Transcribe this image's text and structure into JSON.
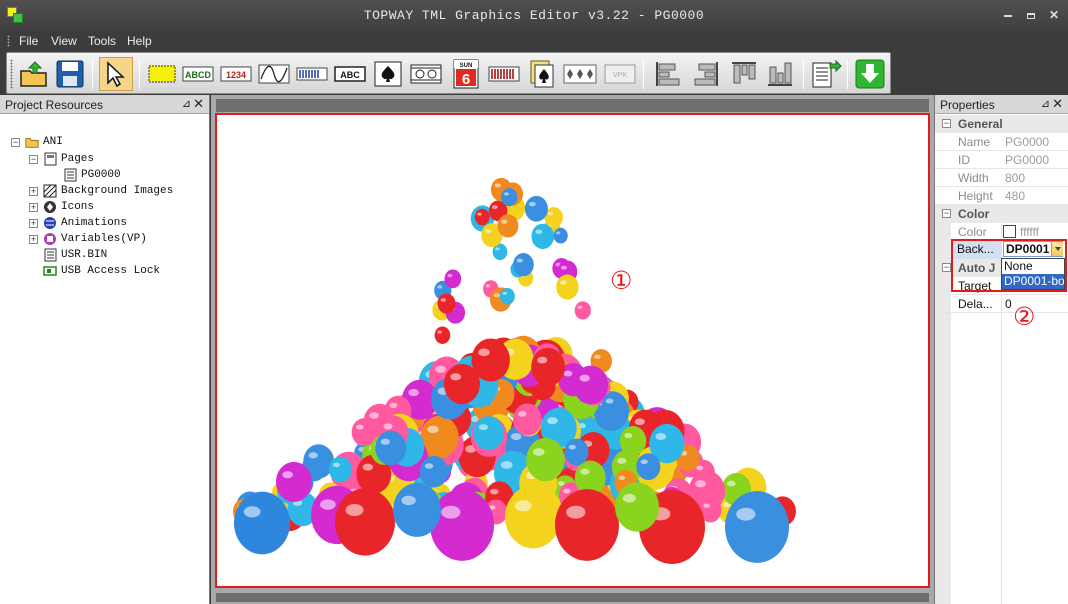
{
  "app": {
    "title": "TOPWAY TML Graphics Editor v3.22 - PG0000"
  },
  "window_controls": {
    "minimize": "",
    "maximize": "",
    "close": "✕"
  },
  "menu": {
    "file": "File",
    "view": "View",
    "tools": "Tools",
    "help": "Help"
  },
  "toolbar": {
    "buttons": [
      "new-project",
      "save",
      "select",
      "rectangle",
      "text-abcd",
      "number-1234",
      "curve",
      "progress-bar",
      "text-box-abc",
      "icon",
      "animation",
      "calendar",
      "bar-graph",
      "card-icon",
      "card-group",
      "vpk",
      "align-left",
      "align-right",
      "align-top",
      "align-bottom",
      "export",
      "download"
    ],
    "text_labels": {
      "abcd": "ABCD",
      "num": "1234",
      "abc": "ABC",
      "cal_day": "SUN",
      "cal_num": "6",
      "vpk": "VPK"
    }
  },
  "project_resources": {
    "title": "Project Resources",
    "pin": "⊿",
    "close": "✕",
    "tree": {
      "root": "ANI",
      "pages": "Pages",
      "page_item": "PG0000",
      "background_images": "Background Images",
      "icons": "Icons",
      "animations": "Animations",
      "variables": "Variables(VP)",
      "usr_bin": "USR.BIN",
      "usb_lock": "USB Access Lock"
    }
  },
  "canvas": {
    "marker": "①"
  },
  "properties": {
    "title": "Properties",
    "pin": "⊿",
    "close": "✕",
    "general": {
      "label": "General",
      "name_key": "Name",
      "name_val": "PG0000",
      "id_key": "ID",
      "id_val": "PG0000",
      "width_key": "Width",
      "width_val": "800",
      "height_key": "Height",
      "height_val": "480"
    },
    "color": {
      "label": "Color",
      "color_key": "Color",
      "color_val": "ffffff",
      "back_key": "Back...",
      "back_val": "DP0001",
      "options": [
        "None",
        "DP0001-bo"
      ]
    },
    "auto": {
      "label": "Auto J",
      "target_key": "Target",
      "target_val": "None",
      "delay_key": "Dela...",
      "delay_val": "0"
    },
    "marker": "②"
  },
  "colors": {
    "highlight_red": "#e21b1b",
    "selection_blue": "#3168c6",
    "panel_gray": "#d7d7d7"
  }
}
